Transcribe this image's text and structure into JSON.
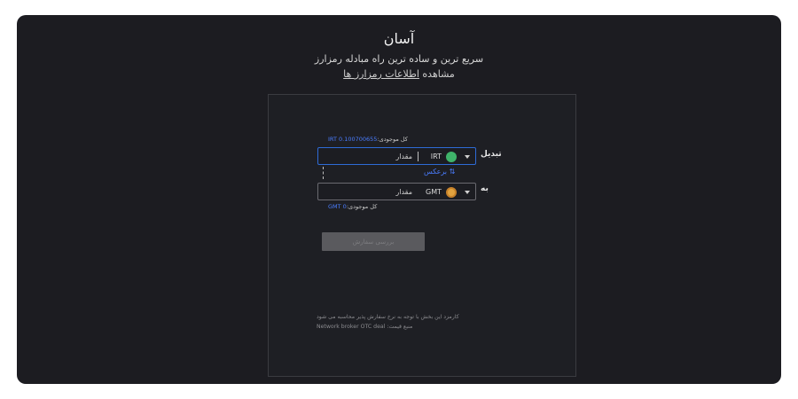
{
  "header": {
    "title": "آسان",
    "subtitle": "سریع ترین و ساده ترین راه مبادله رمزارز",
    "info_prefix": "مشاهده",
    "info_link": "اطلاعات رمزارز ها"
  },
  "exchange": {
    "from": {
      "side_label": "تبدیل",
      "balance_label": "کل موجودی:",
      "balance_value": "IRT 0.100700655",
      "currency_code": "IRT",
      "currency_icon": "irt-coin-icon",
      "amount_placeholder": "مقدار"
    },
    "swap_label": "⇅ برعکس",
    "to": {
      "side_label": "به",
      "balance_label": "کل موجودی:",
      "balance_value": "GMT 0",
      "currency_code": "GMT",
      "currency_icon": "gmt-coin-icon",
      "amount_placeholder": "مقدار"
    },
    "submit_label": "بررسی سفارش"
  },
  "notes": {
    "fee_note": "کارمزد این بخش با توجه به نرخ سفارش پذیر محاسبه می شود",
    "price_source": "Network broker OTC deal :منبع قیمت"
  },
  "colors": {
    "background": "#1c1c21",
    "panel": "#1e1f24",
    "accent": "#4a7dff",
    "active_border": "#2e6bd6",
    "irt_coin": "#3fb36a",
    "gmt_coin": "#e2a33f"
  }
}
